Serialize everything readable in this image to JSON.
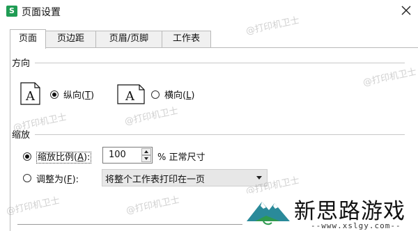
{
  "window": {
    "app_icon_letter": "S",
    "title": "页面设置"
  },
  "tabs": [
    {
      "label": "页面",
      "active": true
    },
    {
      "label": "页边距",
      "active": false
    },
    {
      "label": "页眉/页脚",
      "active": false
    },
    {
      "label": "工作表",
      "active": false
    }
  ],
  "orientation": {
    "group_label": "方向",
    "page_glyph": "A",
    "portrait_label": "纵向(",
    "portrait_key": "T",
    "portrait_suffix": ")",
    "portrait_selected": true,
    "landscape_label": "横向(",
    "landscape_key": "L",
    "landscape_suffix": ")",
    "landscape_selected": false
  },
  "scaling": {
    "group_label": "缩放",
    "scale_label": "缩放比例(",
    "scale_key": "A",
    "scale_suffix": "):",
    "scale_selected": true,
    "scale_value": "100",
    "scale_unit": "% 正常尺寸",
    "fit_label": "调整为(",
    "fit_key": "F",
    "fit_suffix": "):",
    "fit_selected": false,
    "fit_value": "将整个工作表打印在一页"
  },
  "watermark_text": "@打印机卫士",
  "brand": {
    "name": "新思路游戏",
    "url": "--www.xslgy.com--",
    "colors": {
      "mountain": "#2a8a9a",
      "green": "#2e9a4e"
    }
  }
}
